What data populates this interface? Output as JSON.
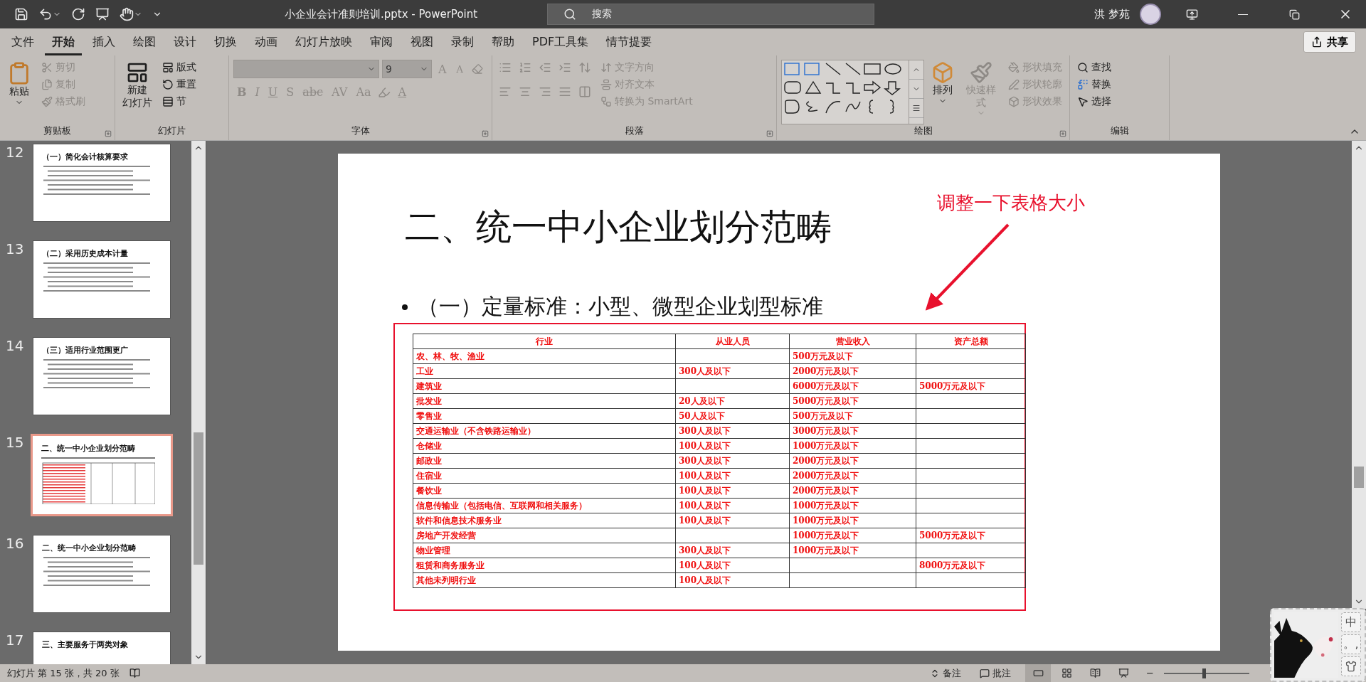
{
  "title_bar": {
    "title": "小企业会计准则培训.pptx  -  PowerPoint",
    "search_placeholder": "搜索",
    "user": "洪 梦苑"
  },
  "tabs": [
    {
      "label": "文件",
      "selected": false
    },
    {
      "label": "开始",
      "selected": true
    },
    {
      "label": "插入",
      "selected": false
    },
    {
      "label": "绘图",
      "selected": false
    },
    {
      "label": "设计",
      "selected": false
    },
    {
      "label": "切换",
      "selected": false
    },
    {
      "label": "动画",
      "selected": false
    },
    {
      "label": "幻灯片放映",
      "selected": false
    },
    {
      "label": "审阅",
      "selected": false
    },
    {
      "label": "视图",
      "selected": false
    },
    {
      "label": "录制",
      "selected": false
    },
    {
      "label": "帮助",
      "selected": false
    },
    {
      "label": "PDF工具集",
      "selected": false
    },
    {
      "label": "情节提要",
      "selected": false
    }
  ],
  "share_button": "共享",
  "ribbon": [
    {
      "kind": "clipboard",
      "label": "剪贴板",
      "main": "粘贴",
      "commands": [
        {
          "label": "剪切",
          "disabled": true
        },
        {
          "label": "复制",
          "disabled": true
        },
        {
          "label": "格式刷",
          "disabled": true
        }
      ]
    },
    {
      "kind": "slides",
      "label": "幻灯片",
      "main_lines": [
        "新建",
        "幻灯片"
      ],
      "commands": [
        {
          "label": "版式",
          "disabled": false
        },
        {
          "label": "重置",
          "disabled": false
        },
        {
          "label": "节",
          "disabled": false
        }
      ]
    },
    {
      "kind": "font",
      "label": "字体",
      "disabled": true,
      "font_size": "9",
      "grow": "A",
      "shrink": "A",
      "buttons": [
        "B",
        "I",
        "U",
        "S",
        "abc",
        "AV",
        "Aa"
      ],
      "font_color": "A"
    },
    {
      "kind": "paragraph",
      "label": "段落",
      "commands": [
        {
          "label": "文字方向",
          "disabled": true
        },
        {
          "label": "对齐文本",
          "disabled": true
        },
        {
          "label": "转换为 SmartArt",
          "disabled": true
        }
      ]
    },
    {
      "kind": "drawing",
      "label": "绘图",
      "main": "排列",
      "quick_styles": {
        "label": "快速样式",
        "disabled": true
      },
      "commands": [
        {
          "label": "形状填充",
          "disabled": true
        },
        {
          "label": "形状轮廓",
          "disabled": true
        },
        {
          "label": "形状效果",
          "disabled": true
        }
      ]
    },
    {
      "kind": "editing",
      "label": "编辑",
      "commands": [
        {
          "label": "查找",
          "disabled": false
        },
        {
          "label": "替换",
          "disabled": false
        },
        {
          "label": "选择",
          "disabled": false
        }
      ]
    }
  ],
  "thumbnails": [
    {
      "number": "12",
      "title": "（一）简化会计核算要求",
      "kind": "text",
      "selected": false
    },
    {
      "number": "13",
      "title": "（二）采用历史成本计量",
      "kind": "text",
      "selected": false
    },
    {
      "number": "14",
      "title": "（三）适用行业范围更广",
      "kind": "text",
      "selected": false
    },
    {
      "number": "15",
      "title": "二、统一中小企业划分范畴",
      "kind": "table",
      "selected": true
    },
    {
      "number": "16",
      "title": "二、统一中小企业划分范畴",
      "kind": "text",
      "selected": false
    },
    {
      "number": "17",
      "title": "三、主要服务于两类对象",
      "kind": "title",
      "selected": false
    }
  ],
  "slide": {
    "title": "二、统一中小企业划分范畴",
    "bullet": "（一）定量标准：小型、微型企业划型标准",
    "annotation": "调整一下表格大小",
    "table": {
      "columns": [
        "行业",
        "从业人员",
        "营业收入",
        "资产总额"
      ],
      "rows": [
        [
          "农、林、牧、渔业",
          null,
          "500万元及以下",
          null
        ],
        [
          "工业",
          "300人及以下",
          "2000万元及以下",
          null
        ],
        [
          "建筑业",
          null,
          "6000万元及以下",
          "5000万元及以下"
        ],
        [
          "批发业",
          "20人及以下",
          "5000万元及以下",
          null
        ],
        [
          "零售业",
          "50人及以下",
          "500万元及以下",
          null
        ],
        [
          "交通运输业（不含铁路运输业）",
          "300人及以下",
          "3000万元及以下",
          null
        ],
        [
          "仓储业",
          "100人及以下",
          "1000万元及以下",
          null
        ],
        [
          "邮政业",
          "300人及以下",
          "2000万元及以下",
          null
        ],
        [
          "住宿业",
          "100人及以下",
          "2000万元及以下",
          null
        ],
        [
          "餐饮业",
          "100人及以下",
          "2000万元及以下",
          null
        ],
        [
          "信息传输业（包括电信、互联网和相关服务）",
          "100人及以下",
          "1000万元及以下",
          null
        ],
        [
          "软件和信息技术服务业",
          "100人及以下",
          "1000万元及以下",
          null
        ],
        [
          "房地产开发经营",
          null,
          "1000万元及以下",
          "5000万元及以下"
        ],
        [
          "物业管理",
          "300人及以下",
          "1000万元及以下",
          null
        ],
        [
          "租赁和商务服务业",
          "100人及以下",
          null,
          "8000万元及以下"
        ],
        [
          "其他未列明行业",
          "100人及以下",
          null,
          null
        ]
      ]
    }
  },
  "status_bar": {
    "slide_info": "幻灯片 第 15 张，共 20 张",
    "notes": "备注",
    "comments": "批注",
    "views": [
      {
        "selected": true
      },
      {
        "selected": false
      },
      {
        "selected": false
      },
      {
        "selected": false
      }
    ],
    "zoom_out": "−",
    "zoom": {
      "level": 0.45
    }
  },
  "ime": {
    "keys": [
      "中",
      "。,"
    ]
  }
}
